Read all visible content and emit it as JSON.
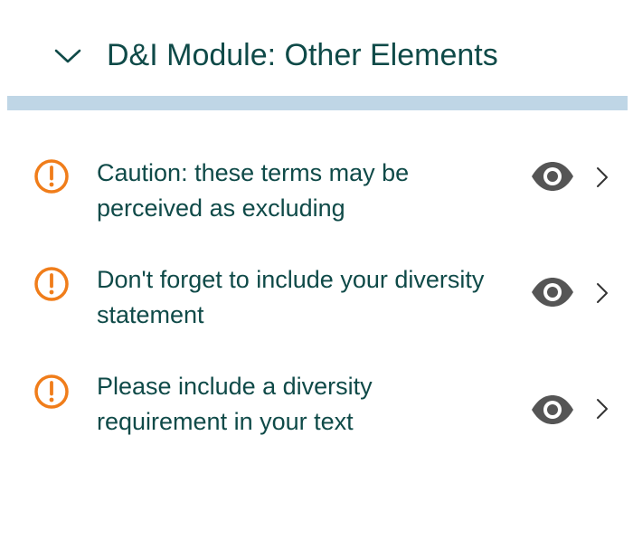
{
  "module": {
    "title": "D&I Module: Other Elements",
    "expanded_icon": "chevron-down-icon"
  },
  "colors": {
    "title_text": "#0f4a48",
    "divider": "#bfd6e6",
    "warning": "#f07d1a",
    "eye": "#555555",
    "chevron": "#333333"
  },
  "items": [
    {
      "text_line1": "Caution: these terms may be",
      "text_line2": "perceived as excluding",
      "status_icon": "warning-circle-icon",
      "view_icon": "eye-icon",
      "open_icon": "chevron-right-icon"
    },
    {
      "text_line1": "Don't forget to include your diversity",
      "text_line2": "statement",
      "status_icon": "warning-circle-icon",
      "view_icon": "eye-icon",
      "open_icon": "chevron-right-icon"
    },
    {
      "text_line1": "Please include a diversity",
      "text_line2": "requirement in your text",
      "status_icon": "warning-circle-icon",
      "view_icon": "eye-icon",
      "open_icon": "chevron-right-icon"
    }
  ]
}
